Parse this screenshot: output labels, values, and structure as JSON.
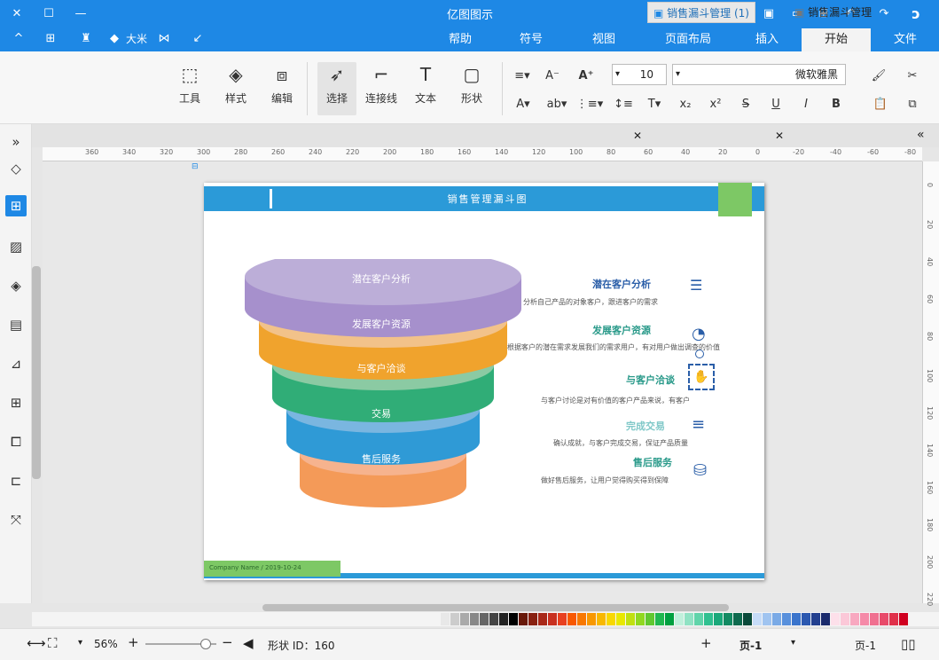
{
  "app": {
    "title": "亿图图示"
  },
  "title_icons": [
    "app-logo-icon",
    "undo-icon",
    "redo-icon",
    "new-icon",
    "open-icon",
    "save-icon",
    "print-icon",
    "export-icon",
    "more-icon",
    "minimize-icon",
    "maximize-icon",
    "close-icon"
  ],
  "quick": {
    "user": "大米"
  },
  "ribbon_tabs": [
    "文件",
    "开始",
    "插入",
    "页面布局",
    "视图",
    "符号",
    "帮助"
  ],
  "ribbon_active": "开始",
  "font": {
    "family": "微软雅黑",
    "size": "10"
  },
  "tools": {
    "shape": "形状",
    "text": "文本",
    "connector": "连接线",
    "select": "选择",
    "edit": "编辑",
    "style": "样式",
    "tools": "工具"
  },
  "doc_tabs": [
    {
      "label": "销售漏斗管理"
    },
    {
      "label": "销售漏斗管理 (1)"
    }
  ],
  "ruler_h": [
    "-80",
    "-60",
    "-40",
    "-20",
    "0",
    "20",
    "40",
    "60",
    "80",
    "100",
    "120",
    "140",
    "160",
    "180",
    "200",
    "220",
    "240",
    "260",
    "280",
    "300",
    "320",
    "340",
    "360"
  ],
  "ruler_v": [
    "0",
    "20",
    "40",
    "60",
    "80",
    "100",
    "120",
    "140",
    "160",
    "180",
    "200",
    "220"
  ],
  "diagram": {
    "header_title": "销售管理漏斗图",
    "funnel": [
      "潜在客户分析",
      "发展客户资源",
      "与客户洽谈",
      "交易",
      "售后服务"
    ],
    "features": [
      {
        "title": "潜在客户分析",
        "desc": "分析自己产品的对象客户，跟进客户的需求"
      },
      {
        "title": "发展客户资源",
        "desc": "根据客户的潜在需求发展我们的需求用户，有对用户做出调查的价值"
      },
      {
        "title": "与客户洽谈",
        "desc": "与客户讨论是对有价值的客户产品来说，有客户"
      },
      {
        "title": "完成交易",
        "desc": "确认成就，与客户完成交易，保证产品质量"
      },
      {
        "title": "售后服务",
        "desc": "做好售后服务，让用户觉得购买得到保障"
      }
    ],
    "footer": "Company Name / 2019-10-24"
  },
  "status": {
    "page_nav": "页-1",
    "page_tab": "页-1",
    "shape_id": "形状 ID：160",
    "zoom": "56%"
  },
  "colors": {
    "accent": "#1e88e5",
    "banner": "#2b9ad8",
    "green": "#7dc865",
    "purple": "#b8a8d4",
    "orange": "#f2c28a",
    "teal": "#8bcaa3",
    "blue": "#7ab6e0",
    "salmon": "#f4ad84"
  }
}
